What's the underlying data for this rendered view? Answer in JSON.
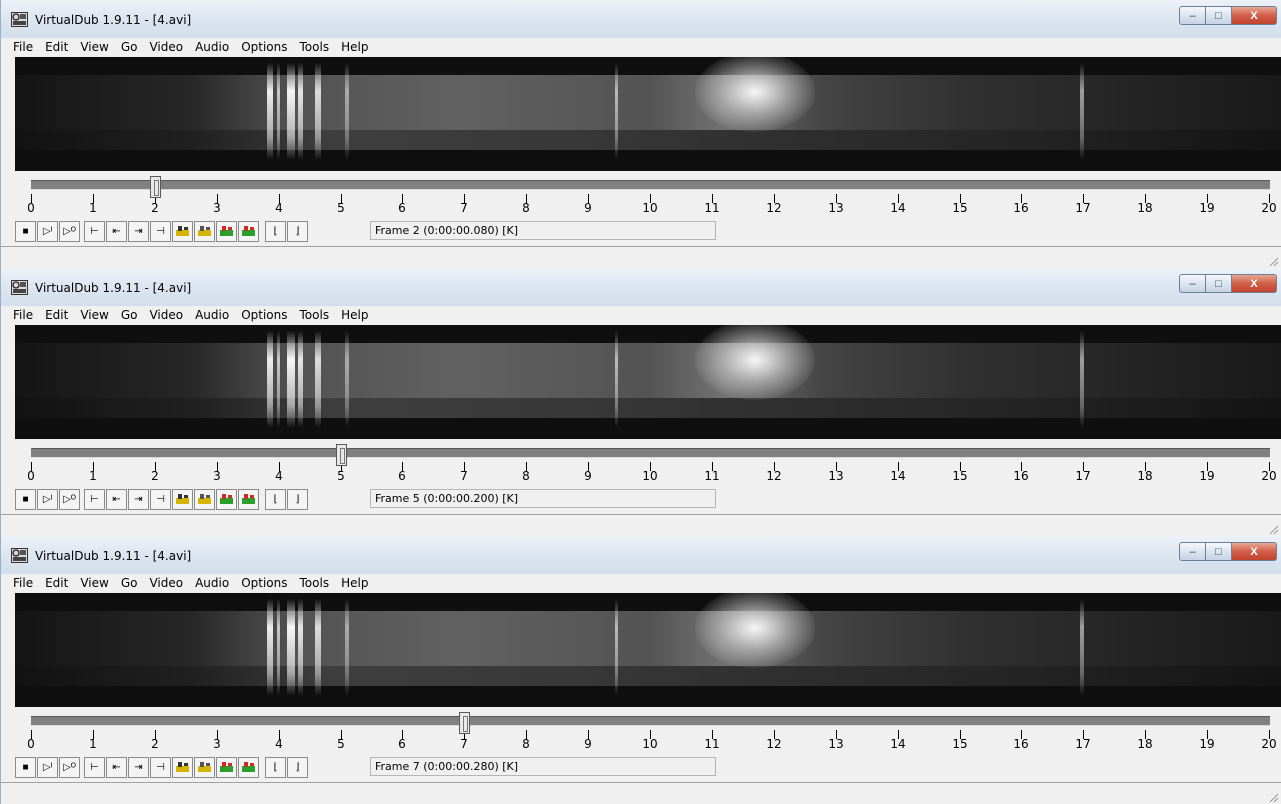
{
  "windows": [
    {
      "title": "VirtualDub 1.9.11 - [4.avi]",
      "menu": [
        "File",
        "Edit",
        "View",
        "Go",
        "Video",
        "Audio",
        "Options",
        "Tools",
        "Help"
      ],
      "frame_info": "Frame 2 (0:00:00.080) [K]",
      "position_frame": 2,
      "scale_labels": [
        "0",
        "1",
        "2",
        "3",
        "4",
        "5",
        "6",
        "7",
        "8",
        "9",
        "10",
        "11",
        "12",
        "13",
        "14",
        "15",
        "16",
        "17",
        "18",
        "19",
        "20"
      ],
      "window_buttons": {
        "minimize": "–",
        "maximize": "□",
        "close": "X"
      }
    },
    {
      "title": "VirtualDub 1.9.11 - [4.avi]",
      "menu": [
        "File",
        "Edit",
        "View",
        "Go",
        "Video",
        "Audio",
        "Options",
        "Tools",
        "Help"
      ],
      "frame_info": "Frame 5 (0:00:00.200) [K]",
      "position_frame": 5,
      "scale_labels": [
        "0",
        "1",
        "2",
        "3",
        "4",
        "5",
        "6",
        "7",
        "8",
        "9",
        "10",
        "11",
        "12",
        "13",
        "14",
        "15",
        "16",
        "17",
        "18",
        "19",
        "20"
      ],
      "window_buttons": {
        "minimize": "–",
        "maximize": "□",
        "close": "X"
      }
    },
    {
      "title": "VirtualDub 1.9.11 - [4.avi]",
      "menu": [
        "File",
        "Edit",
        "View",
        "Go",
        "Video",
        "Audio",
        "Options",
        "Tools",
        "Help"
      ],
      "frame_info": "Frame 7 (0:00:00.280) [K]",
      "position_frame": 7,
      "scale_labels": [
        "0",
        "1",
        "2",
        "3",
        "4",
        "5",
        "6",
        "7",
        "8",
        "9",
        "10",
        "11",
        "12",
        "13",
        "14",
        "15",
        "16",
        "17",
        "18",
        "19",
        "20"
      ],
      "window_buttons": {
        "minimize": "–",
        "maximize": "□",
        "close": "X"
      }
    }
  ],
  "timeline_max_frame": 20,
  "toolbar_icons": [
    "stop-icon",
    "play-input-icon",
    "play-output-icon",
    "go-start-icon",
    "prev-keyframe-icon",
    "next-keyframe-icon",
    "go-end-icon",
    "prev-scene-icon",
    "next-scene-icon",
    "mark-in-scene-icon",
    "mark-out-scene-icon",
    "mark-in-icon",
    "mark-out-icon"
  ],
  "colors": {
    "titlebar": "#dde6f1",
    "close_button": "#c2402b",
    "video_background": "#0f0f0f",
    "track": "#808080"
  }
}
